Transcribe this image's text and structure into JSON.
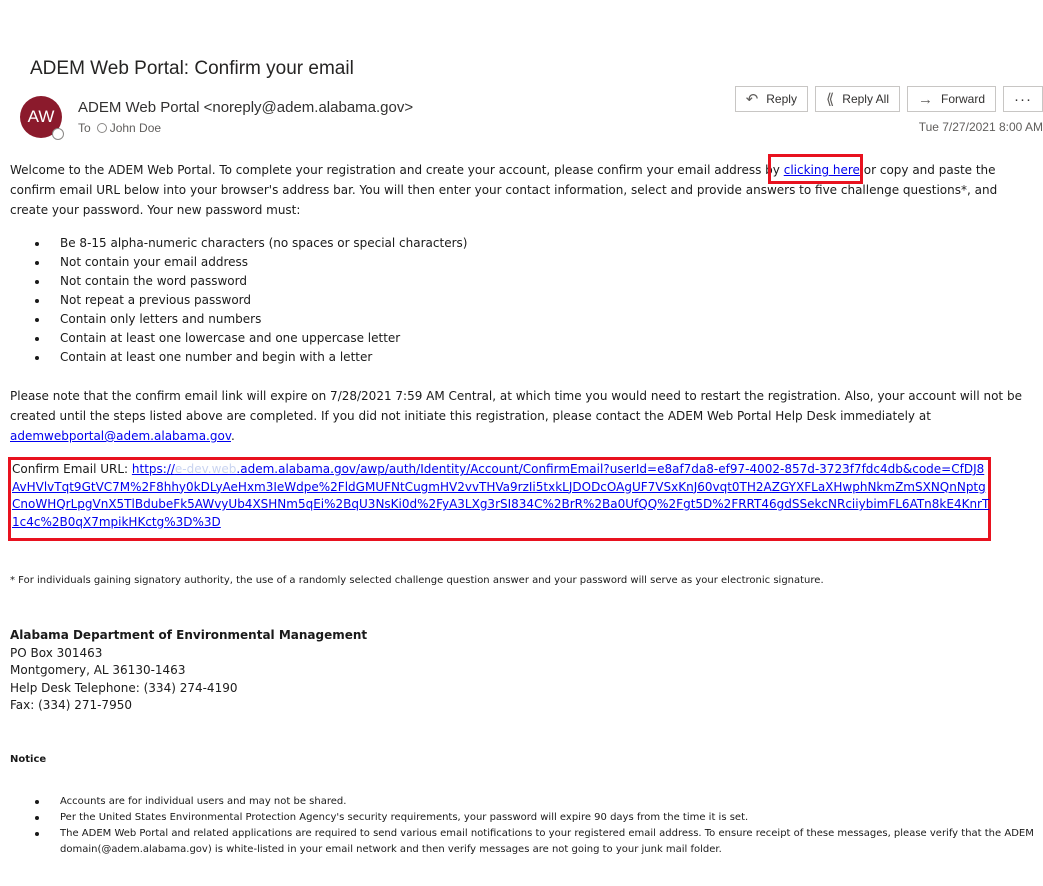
{
  "subject": "ADEM Web Portal: Confirm your email",
  "sender": {
    "initials": "AW",
    "name": "ADEM Web Portal <noreply@adem.alabama.gov>",
    "to_label": "To",
    "to_name": "John Doe",
    "avatar_color": "#8b1a2c"
  },
  "actions": {
    "reply": "Reply",
    "reply_all": "Reply All",
    "forward": "Forward",
    "more": "···"
  },
  "date": "Tue 7/27/2021 8:00 AM",
  "body": {
    "intro_1": "Welcome to the ADEM Web Portal. To complete your registration and create your account, please confirm your email address by ",
    "intro_link": "clicking here",
    "intro_2": " or copy and paste the confirm email URL below into your browser's address bar. You will then enter your contact information, select and provide answers to five challenge questions*, and create your password. Your new password must:",
    "requirements": [
      "Be 8-15 alpha-numeric characters (no spaces or special characters)",
      "Not contain your email address",
      "Not contain the word password",
      "Not repeat a previous password",
      "Contain only letters and numbers",
      "Contain at least one lowercase and one uppercase letter",
      "Contain at least one number and begin with a letter"
    ],
    "note_1": "Please note that the confirm email link will expire on 7/28/2021 7:59 AM Central, at which time you would need to restart the registration. Also, your account will not be created until the steps listed above are completed. If you did not initiate this registration, please contact the ADEM Web Portal Help Desk immediately at ",
    "help_email": "ademwebportal@adem.alabama.gov",
    "note_end": ".",
    "url_label": "Confirm Email URL: ",
    "url_start": "https://",
    "url_blurred": "e-dev.web",
    "url_rest": ".adem.alabama.gov/awp/auth/Identity/Account/ConfirmEmail?userId=e8af7da8-ef97-4002-857d-3723f7fdc4db&code=CfDJ8AvHVlvTqt9GtVC7M%2F8hhy0kDLyAeHxm3IeWdpe%2FldGMUFNtCugmHV2vvTHVa9rzIi5txkLJDODcOAgUF7VSxKnJ60vqt0TH2AZGYXFLaXHwphNkmZmSXNQnNptgCnoWHQrLpgVnX5TlBdubeFk5AWvyUb4XSHNm5qEi%2BqU3NsKi0d%2FyA3LXg3rSI834C%2BrR%2Ba0UfQQ%2Fgt5D%2FRRT46gdSSekcNRciiybimFL6ATn8kE4KnrT1c4c%2B0qX7mpikHKctg%3D%3D",
    "footnote": "* For individuals gaining signatory authority, the use of a randomly selected challenge question answer and your password will serve as your electronic signature."
  },
  "org": {
    "name": "Alabama Department of Environmental Management",
    "box": "PO Box 301463",
    "city": "Montgomery, AL 36130-1463",
    "phone": "Help Desk Telephone: (334) 274-4190",
    "fax": "Fax: (334) 271-7950"
  },
  "notice": {
    "heading": "Notice",
    "items": [
      "Accounts are for individual users and may not be shared.",
      "Per the United States Environmental Protection Agency's security requirements, your password will expire 90 days from the time it is set.",
      "The ADEM Web Portal and related applications are required to send various email notifications to your registered email address. To ensure receipt of these messages, please verify that the ADEM domain(@adem.alabama.gov) is white-listed in your email network and then verify messages are not going to your junk mail folder."
    ]
  }
}
